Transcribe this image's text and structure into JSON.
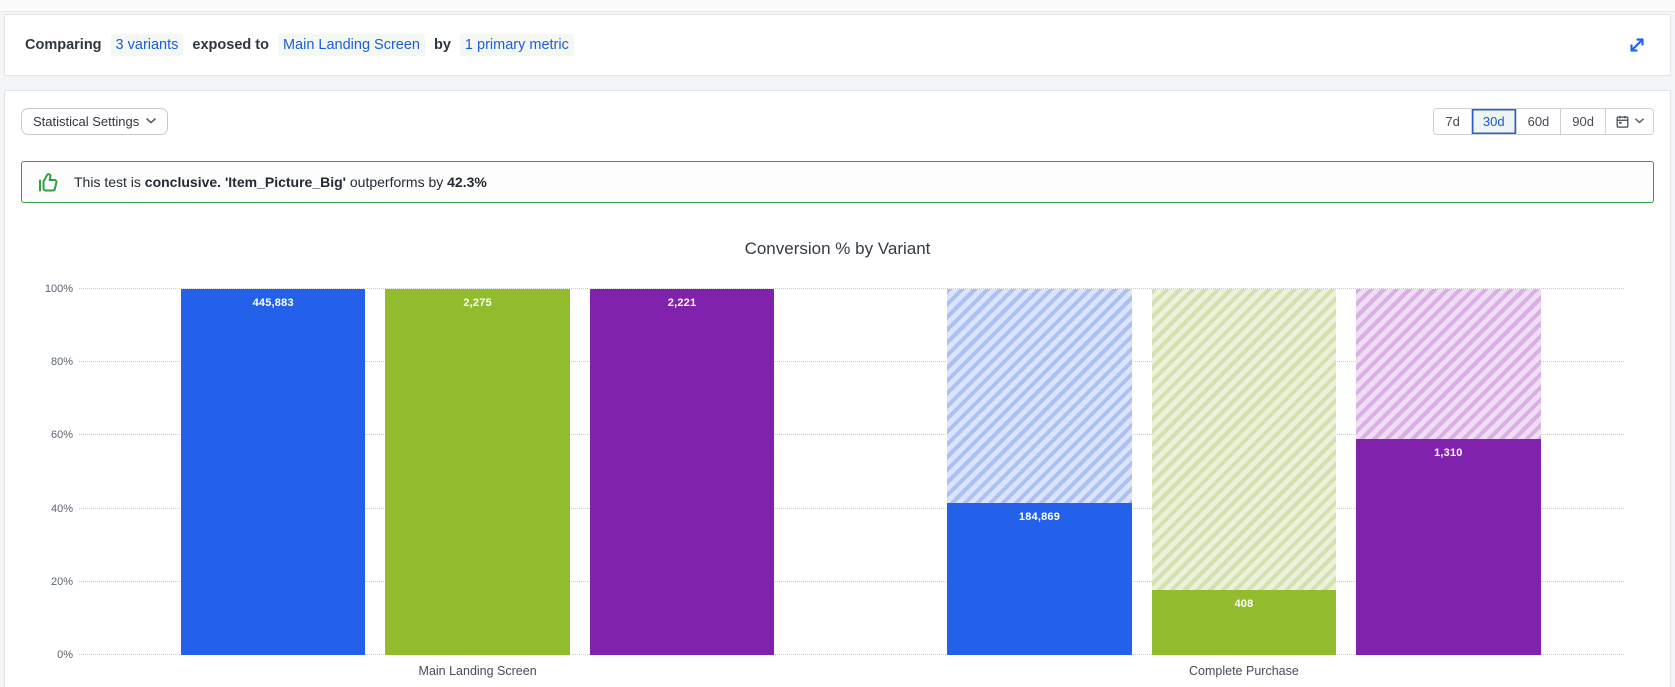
{
  "header": {
    "prefix": "Comparing",
    "variants_link": "3 variants",
    "exposed_to": "exposed to",
    "exposure_link": "Main Landing Screen",
    "by_word": "by",
    "metric_link": "1 primary metric",
    "link_color": "#1e5dd9",
    "expand_icon": "expand-diagonal-arrows"
  },
  "toolbar": {
    "statistical_settings_label": "Statistical Settings",
    "date_ranges": [
      {
        "label": "7d",
        "selected": false
      },
      {
        "label": "30d",
        "selected": true
      },
      {
        "label": "60d",
        "selected": false
      },
      {
        "label": "90d",
        "selected": false
      }
    ],
    "calendar_icon": "calendar",
    "selected_range": "30d",
    "selected_color": "#1f55cf"
  },
  "banner": {
    "icon": "thumbs-up",
    "icon_color": "#2f9e44",
    "text_prefix": "This test is",
    "conclusive_word": "conclusive.",
    "variant_name": "'Item_Picture_Big'",
    "middle_text": "outperforms by",
    "lift_value": "42.3%",
    "border_color": "#2f9e44"
  },
  "chart_data": {
    "type": "bar",
    "title": "Conversion % by Variant",
    "ylim": [
      0,
      100
    ],
    "yticks": [
      "0%",
      "20%",
      "40%",
      "60%",
      "80%",
      "100%"
    ],
    "grid": "horizontal-dotted",
    "legend": "none",
    "stacked_remainder_hatched": true,
    "categories": [
      "Main Landing Screen",
      "Complete Purchase"
    ],
    "groups": [
      {
        "category": "Main Landing Screen",
        "bars": [
          {
            "series": "blue",
            "color": "#2361eb",
            "pct": 100,
            "label": "445,883",
            "value": 445883,
            "remainder_hatched": false
          },
          {
            "series": "green",
            "color": "#92bb2e",
            "pct": 100,
            "label": "2,275",
            "value": 2275,
            "remainder_hatched": false
          },
          {
            "series": "purple",
            "color": "#8122ac",
            "pct": 100,
            "label": "2,221",
            "value": 2221,
            "remainder_hatched": false
          }
        ]
      },
      {
        "category": "Complete Purchase",
        "bars": [
          {
            "series": "blue",
            "color": "#2361eb",
            "pct": 41.5,
            "label": "184,869",
            "value": 184869,
            "remainder_hatched": true,
            "hatch_bg": "#dbe4fb",
            "hatch_stripe": "#abc1f6"
          },
          {
            "series": "green",
            "color": "#92bb2e",
            "pct": 17.9,
            "label": "408",
            "value": 408,
            "remainder_hatched": true,
            "hatch_bg": "#ebf1da",
            "hatch_stripe": "#d4e0ad"
          },
          {
            "series": "purple",
            "color": "#8122ac",
            "pct": 59.0,
            "label": "1,310",
            "value": 1310,
            "remainder_hatched": true,
            "hatch_bg": "#eeddf4",
            "hatch_stripe": "#d9afe5"
          }
        ]
      }
    ]
  }
}
